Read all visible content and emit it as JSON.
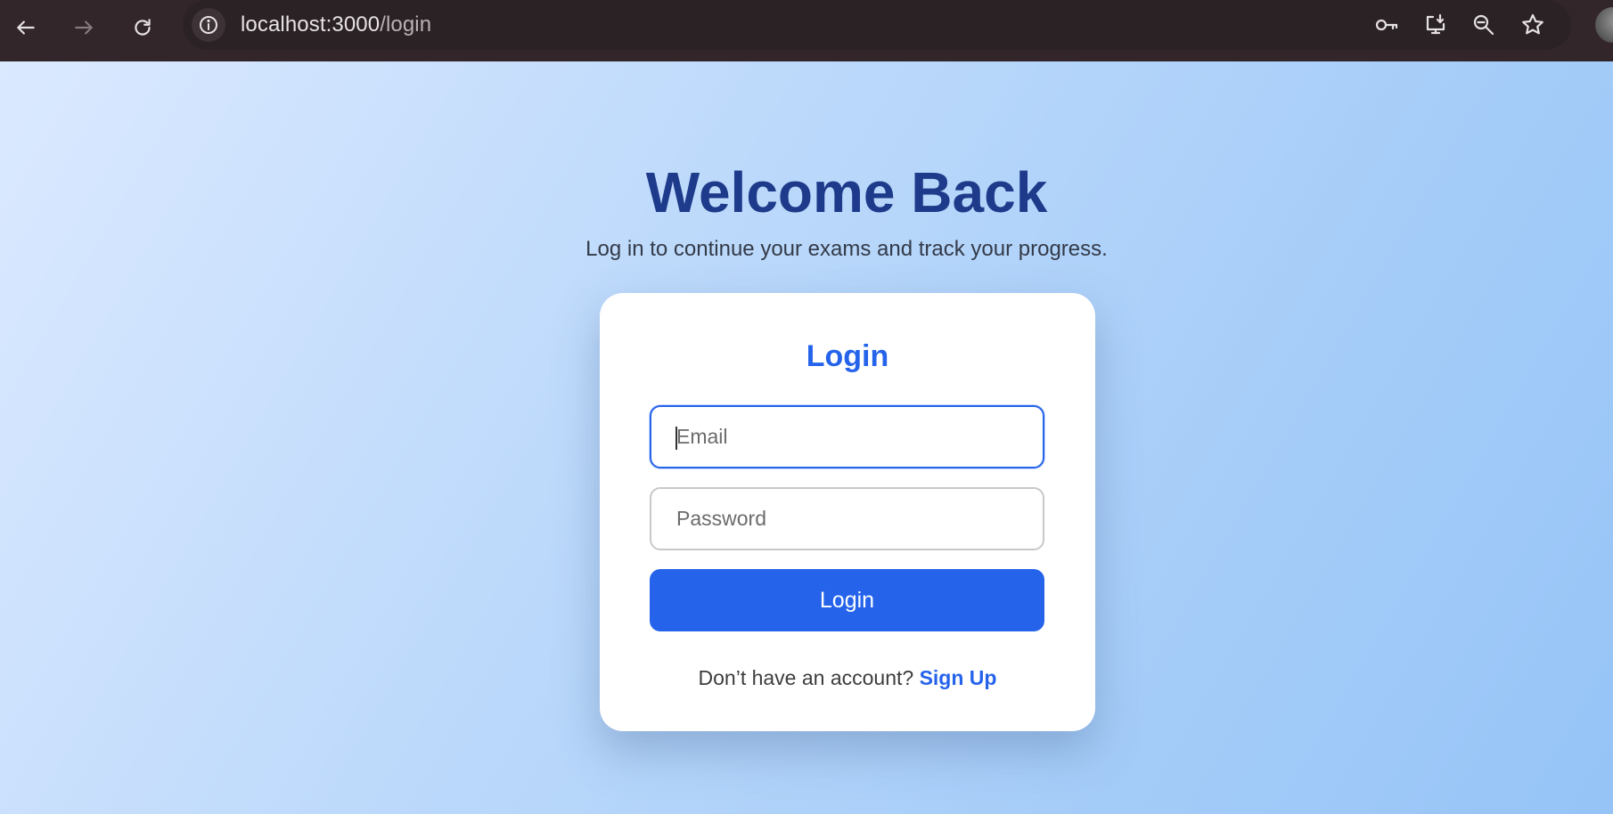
{
  "browser": {
    "url_host": "localhost:3000",
    "url_path": "/login"
  },
  "welcome": {
    "title": "Welcome Back",
    "subtitle": "Log in to continue your exams and track your progress."
  },
  "login_card": {
    "title": "Login",
    "email_placeholder": "Email",
    "email_value": "",
    "password_placeholder": "Password",
    "password_value": "",
    "submit_label": "Login",
    "signup_prompt": "Don’t have an account?",
    "signup_link": "Sign Up"
  },
  "colors": {
    "accent": "#2563eb",
    "heading": "#1e3a8a",
    "chrome_bg": "#33262a"
  },
  "icons": {
    "back": "arrow-left-icon",
    "forward": "arrow-right-icon",
    "reload": "reload-icon",
    "site_info": "info-icon",
    "passwords": "key-icon",
    "install": "install-app-icon",
    "zoom": "zoom-out-icon",
    "bookmark": "star-icon"
  }
}
